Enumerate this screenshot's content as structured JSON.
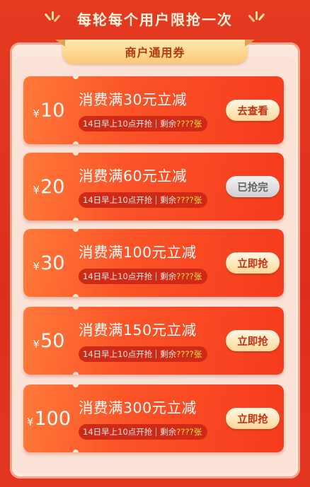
{
  "header": {
    "title": "每轮每个用户限抢一次"
  },
  "ribbon": {
    "label": "商户通用券"
  },
  "coupons": [
    {
      "currency": "¥",
      "amount": "10",
      "title": "消费满30元立减",
      "time": "14日早上10点开抢",
      "remain_label": "剩余",
      "remain_value": "????张",
      "button": "去查看",
      "state": "active"
    },
    {
      "currency": "¥",
      "amount": "20",
      "title": "消费满60元立减",
      "time": "14日早上10点开抢",
      "remain_label": "剩余",
      "remain_value": "????张",
      "button": "已抢完",
      "state": "disabled"
    },
    {
      "currency": "¥",
      "amount": "30",
      "title": "消费满100元立减",
      "time": "14日早上10点开抢",
      "remain_label": "剩余",
      "remain_value": "????张",
      "button": "立即抢",
      "state": "active"
    },
    {
      "currency": "¥",
      "amount": "50",
      "title": "消费满150元立减",
      "time": "14日早上10点开抢",
      "remain_label": "剩余",
      "remain_value": "????张",
      "button": "立即抢",
      "state": "active"
    },
    {
      "currency": "¥",
      "amount": "100",
      "title": "消费满300元立减",
      "time": "14日早上10点开抢",
      "remain_label": "剩余",
      "remain_value": "????张",
      "button": "立即抢",
      "state": "active"
    }
  ],
  "colors": {
    "background": "#e33620",
    "panel": "#fde9dc",
    "coupon_start": "#ff7a3a",
    "coupon_end": "#f63b1d",
    "remain_highlight": "#ffe14a",
    "button_text": "#c23013"
  }
}
